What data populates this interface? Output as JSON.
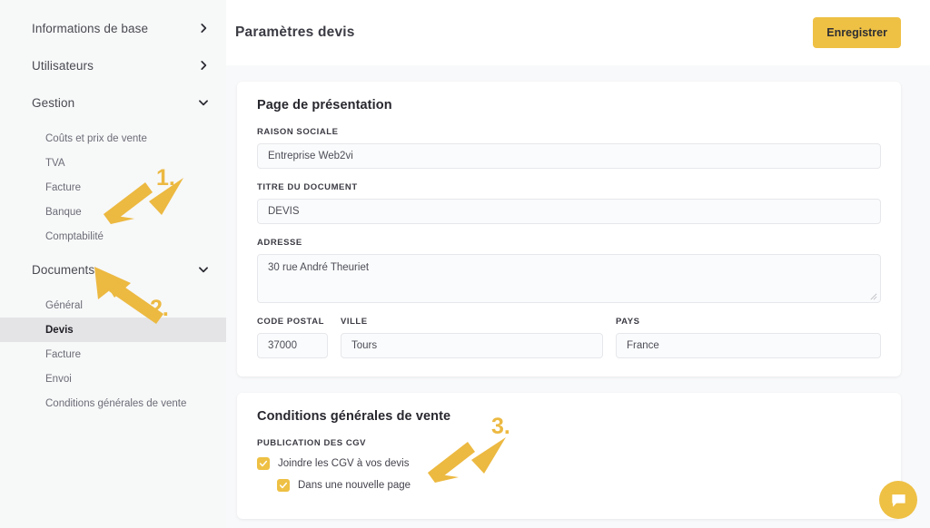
{
  "sidebar": {
    "groups": [
      {
        "label": "Informations de base",
        "icon": "chevron-right-icon",
        "expanded": false,
        "children": []
      },
      {
        "label": "Utilisateurs",
        "icon": "chevron-right-icon",
        "expanded": false,
        "children": []
      },
      {
        "label": "Gestion",
        "icon": "chevron-down-icon",
        "expanded": true,
        "children": [
          {
            "label": "Coûts et prix de vente",
            "active": false
          },
          {
            "label": "TVA",
            "active": false
          },
          {
            "label": "Facture",
            "active": false
          },
          {
            "label": "Banque",
            "active": false
          },
          {
            "label": "Comptabilité",
            "active": false
          }
        ]
      },
      {
        "label": "Documents",
        "icon": "chevron-down-icon",
        "expanded": true,
        "children": [
          {
            "label": "Général",
            "active": false
          },
          {
            "label": "Devis",
            "active": true
          },
          {
            "label": "Facture",
            "active": false
          },
          {
            "label": "Envoi",
            "active": false
          },
          {
            "label": "Conditions générales de vente",
            "active": false
          }
        ]
      }
    ]
  },
  "header": {
    "title": "Paramètres devis",
    "save_label": "Enregistrer"
  },
  "presentation_card": {
    "title": "Page de présentation",
    "fields": [
      {
        "label": "Raison sociale",
        "value": "Entreprise Web2vi"
      },
      {
        "label": "Titre du document",
        "value": "DEVIS"
      },
      {
        "label": "Adresse",
        "value": "30 rue André Theuriet"
      }
    ],
    "address_row": [
      {
        "label": "Code postal",
        "value": "37000"
      },
      {
        "label": "Ville",
        "value": "Tours"
      },
      {
        "label": "Pays",
        "value": "France"
      }
    ]
  },
  "cgv_card": {
    "title": "Conditions générales de vente",
    "section_label": "Publication des CGV",
    "checkboxes": [
      {
        "label": "Joindre les CGV à vos devis",
        "checked": true,
        "indent": false
      },
      {
        "label": "Dans une nouvelle page",
        "checked": true,
        "indent": true
      }
    ]
  },
  "annotations": [
    {
      "number": "1.",
      "target": "documents-nav-group"
    },
    {
      "number": "2.",
      "target": "devis-nav-item"
    },
    {
      "number": "3.",
      "target": "cgv-checkbox-group"
    }
  ],
  "chat": {
    "icon": "chat-bubble-icon"
  },
  "colors": {
    "accent": "#eec044",
    "annotation": "#ecb941",
    "sidebar_bg": "#f7f8f8",
    "active_item_bg": "#e4e4e6",
    "main_bg": "#f8f9fa",
    "card_bg": "#ffffff",
    "text_primary": "#27272e",
    "text_secondary": "#6c6c77"
  }
}
